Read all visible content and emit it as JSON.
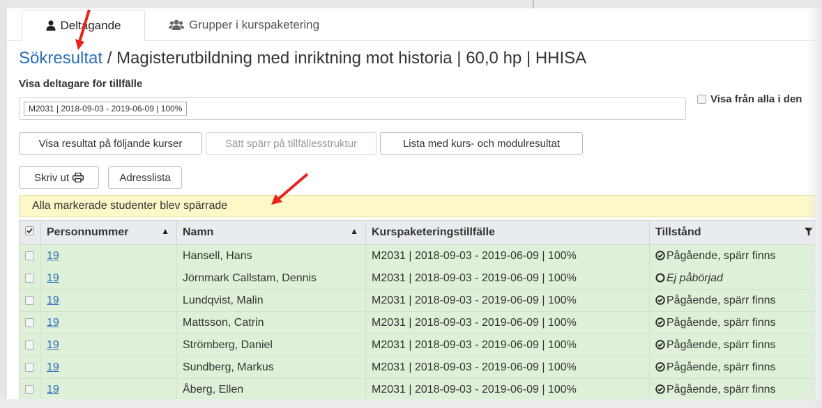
{
  "tabs": [
    {
      "label": "Deltagande",
      "icon": "user-icon",
      "active": true
    },
    {
      "label": "Grupper i kurspaketering",
      "icon": "users-icon",
      "active": false
    }
  ],
  "title": {
    "link": "Sökresultat",
    "rest": " / Magisterutbildning med inriktning mot historia | 60,0 hp | HHISA"
  },
  "visa_label": "Visa deltagare för tillfälle",
  "selected_tillfalle": "M2031 | 2018-09-03 - 2019-06-09 | 100%",
  "show_all_label": "Visa från alla i den",
  "buttons": {
    "visa_resultat": "Visa resultat på följande kurser",
    "satt_sparr": "Sätt spärr på tillfällesstruktur",
    "lista": "Lista med kurs- och modulresultat",
    "skriv_ut": "Skriv ut",
    "adresslista": "Adresslista"
  },
  "alert": "Alla markerade studenter blev spärrade",
  "table": {
    "headers": {
      "personnummer": "Personnummer",
      "namn": "Namn",
      "kurspaket": "Kurspaketeringstillfälle",
      "tillstand": "Tillstånd"
    },
    "rows": [
      {
        "pnr": "19",
        "namn": "Hansell, Hans",
        "tillfalle": "M2031 | 2018-09-03 - 2019-06-09 | 100%",
        "status": "Pågående, spärr finns",
        "started": true
      },
      {
        "pnr": "19",
        "namn": "Jörnmark Callstam, Dennis",
        "tillfalle": "M2031 | 2018-09-03 - 2019-06-09 | 100%",
        "status": "Ej påbörjad",
        "started": false
      },
      {
        "pnr": "19",
        "namn": "Lundqvist, Malin",
        "tillfalle": "M2031 | 2018-09-03 - 2019-06-09 | 100%",
        "status": "Pågående, spärr finns",
        "started": true
      },
      {
        "pnr": "19",
        "namn": "Mattsson, Catrin",
        "tillfalle": "M2031 | 2018-09-03 - 2019-06-09 | 100%",
        "status": "Pågående, spärr finns",
        "started": true
      },
      {
        "pnr": "19",
        "namn": "Strömberg, Daniel",
        "tillfalle": "M2031 | 2018-09-03 - 2019-06-09 | 100%",
        "status": "Pågående, spärr finns",
        "started": true
      },
      {
        "pnr": "19",
        "namn": "Sundberg, Markus",
        "tillfalle": "M2031 | 2018-09-03 - 2019-06-09 | 100%",
        "status": "Pågående, spärr finns",
        "started": true
      },
      {
        "pnr": "19",
        "namn": "Åberg, Ellen",
        "tillfalle": "M2031 | 2018-09-03 - 2019-06-09 | 100%",
        "status": "Pågående, spärr finns",
        "started": true
      }
    ]
  },
  "colors": {
    "link": "#2a6ebb",
    "row_green": "#dff0d8",
    "alert_yellow": "#fcf8c7",
    "annotation_red": "#e8231c"
  }
}
